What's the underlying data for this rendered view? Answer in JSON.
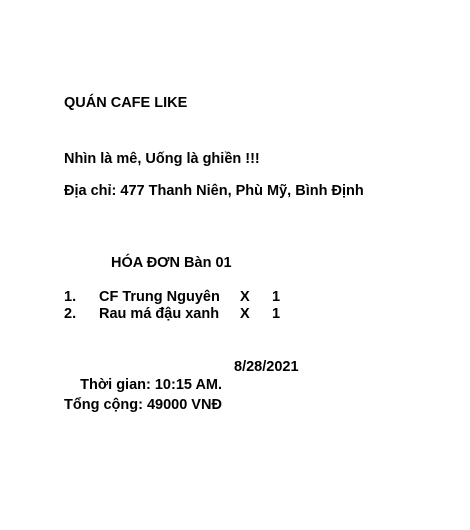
{
  "shop": {
    "name": "QUÁN CAFE LIKE",
    "slogan": "Nhìn là mê, Uống là ghiền !!!",
    "address": "Địa chỉ: 477 Thanh Niên, Phù Mỹ, Bình Định"
  },
  "invoice": {
    "title": "HÓA ĐƠN Bàn 01",
    "items": [
      {
        "number": "1.",
        "name": "CF Trung Nguyên",
        "x": "X",
        "qty": "1"
      },
      {
        "number": "2.",
        "name": "Rau má đậu xanh",
        "x": "X",
        "qty": "1"
      }
    ],
    "time": "Thời gian: 10:15 AM.",
    "date": "8/28/2021",
    "total": "Tổng cộng: 49000 VNĐ"
  }
}
